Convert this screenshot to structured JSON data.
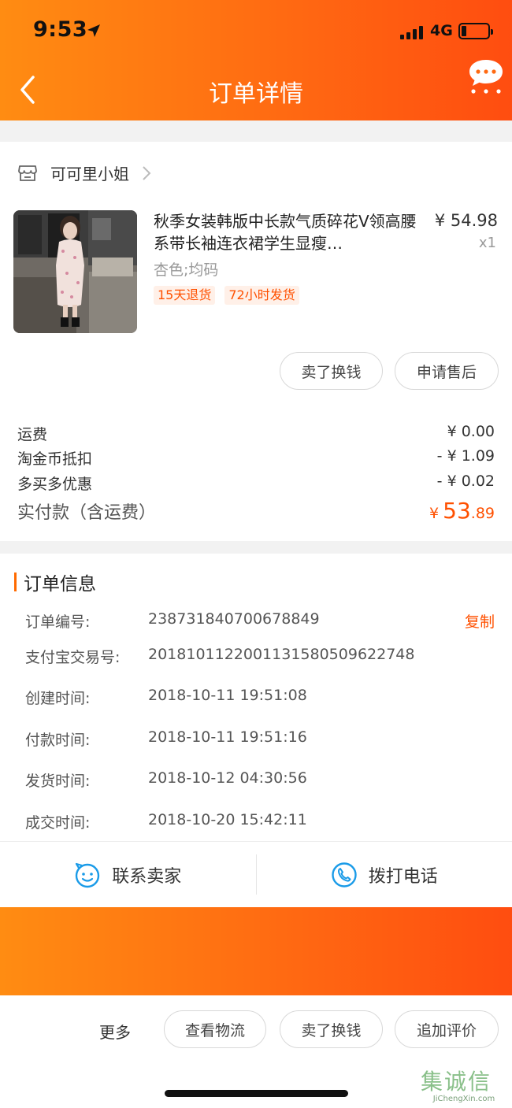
{
  "status_bar": {
    "time": "9:53",
    "network": "4G"
  },
  "nav": {
    "title": "订单详情"
  },
  "store": {
    "name": "可可里小姐"
  },
  "product": {
    "title": "秋季女装韩版中长款气质碎花V领高腰系带长袖连衣裙学生显瘦…",
    "price": "¥ 54.98",
    "qty": "x1",
    "sku": "杏色;均码",
    "tags": [
      "15天退货",
      "72小时发货"
    ]
  },
  "item_actions": {
    "sell": "卖了换钱",
    "after_sale": "申请售后"
  },
  "fees": [
    {
      "label": "运费",
      "value": "¥ 0.00"
    },
    {
      "label": "淘金币抵扣",
      "value": "- ¥ 1.09"
    },
    {
      "label": "多买多优惠",
      "value": "- ¥ 0.02"
    }
  ],
  "total": {
    "label": "实付款（含运费）",
    "currency": "¥",
    "integer": "53",
    "decimal": ".89"
  },
  "order_info": {
    "title": "订单信息",
    "copy": "复制",
    "rows": [
      {
        "label": "订单编号:",
        "value": "238731840700678849"
      },
      {
        "label": "支付宝交易号:",
        "value": "2018101122001131580509622748"
      },
      {
        "label": "创建时间:",
        "value": "2018-10-11 19:51:08"
      },
      {
        "label": "付款时间:",
        "value": "2018-10-11 19:51:16"
      },
      {
        "label": "发货时间:",
        "value": "2018-10-12 04:30:56"
      },
      {
        "label": "成交时间:",
        "value": "2018-10-20 15:42:11"
      }
    ]
  },
  "contact": {
    "seller": "联系卖家",
    "phone": "拨打电话"
  },
  "bottom_bar": {
    "more": "更多",
    "logistics": "查看物流",
    "sell": "卖了换钱",
    "review": "追加评价"
  },
  "watermark": {
    "cn": "集诚信",
    "en": "JiChengXin.com"
  },
  "colors": {
    "brand": "#ff6a12",
    "price_accent": "#ff5000"
  }
}
